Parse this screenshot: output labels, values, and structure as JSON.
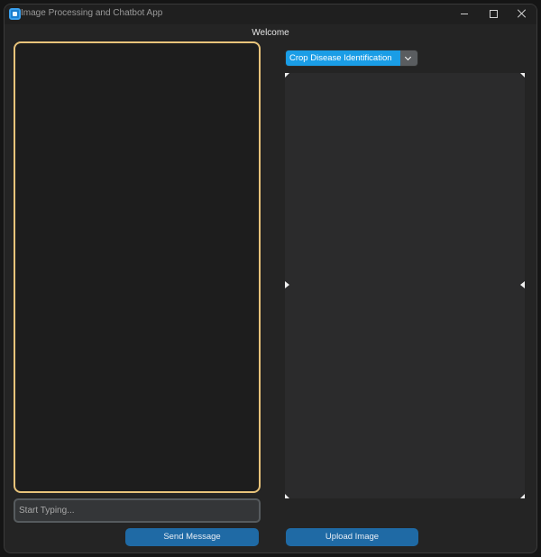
{
  "window": {
    "title": "Image Processing and Chatbot App",
    "controls": {
      "minimize_icon": "minimize-icon",
      "maximize_icon": "maximize-icon",
      "close_icon": "close-icon"
    }
  },
  "header": {
    "welcome": "Welcome"
  },
  "chat": {
    "input_placeholder": "Start Typing...",
    "input_value": "",
    "send_label": "Send Message"
  },
  "image_panel": {
    "mode_selected": "Crop Disease Identification",
    "upload_label": "Upload Image"
  },
  "colors": {
    "accent_blue": "#1f6aa5",
    "dropdown_blue": "#1a9de6",
    "chat_border": "#e8c37a"
  }
}
